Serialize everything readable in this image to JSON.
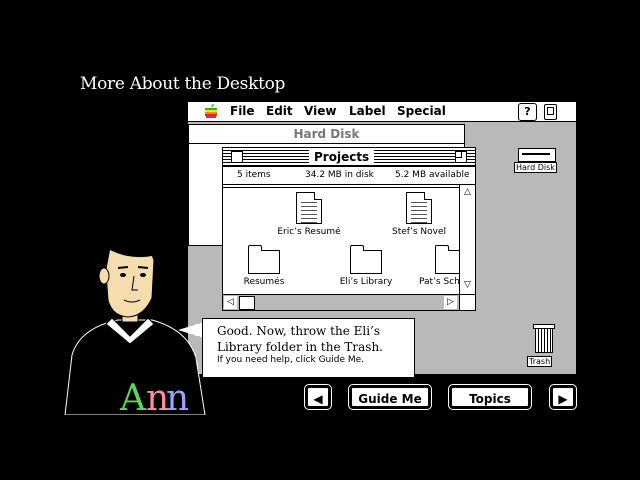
{
  "page_title": "More About the Desktop",
  "menubar": {
    "items": [
      "File",
      "Edit",
      "View",
      "Label",
      "Special"
    ],
    "help_glyph": "?"
  },
  "hard_disk_window": {
    "title": "Hard Disk"
  },
  "projects_window": {
    "title": "Projects",
    "items_count": "5 items",
    "in_disk": "34.2 MB in disk",
    "available": "5.2 MB available",
    "items": [
      {
        "label": "Eric’s Resumé",
        "icon": "document-icon"
      },
      {
        "label": "Stef’s Novel",
        "icon": "document-icon"
      },
      {
        "label": "Resumés",
        "icon": "folder-icon"
      },
      {
        "label": "Eli’s Library",
        "icon": "folder-icon"
      },
      {
        "label": "Pat’s Sch",
        "icon": "folder-icon"
      }
    ]
  },
  "desktop": {
    "disk_label": "Hard Disk",
    "trash_label": "Trash"
  },
  "bubble": {
    "instruction": "Good. Now, throw the Eli’s Library folder in the Trash.",
    "help_hint": "If you need help, click Guide Me."
  },
  "buttons": {
    "guide_me": "Guide Me",
    "topics": "Topics",
    "back_glyph": "◀",
    "forward_glyph": "▶"
  },
  "character": {
    "shirt_text": "Ann"
  }
}
